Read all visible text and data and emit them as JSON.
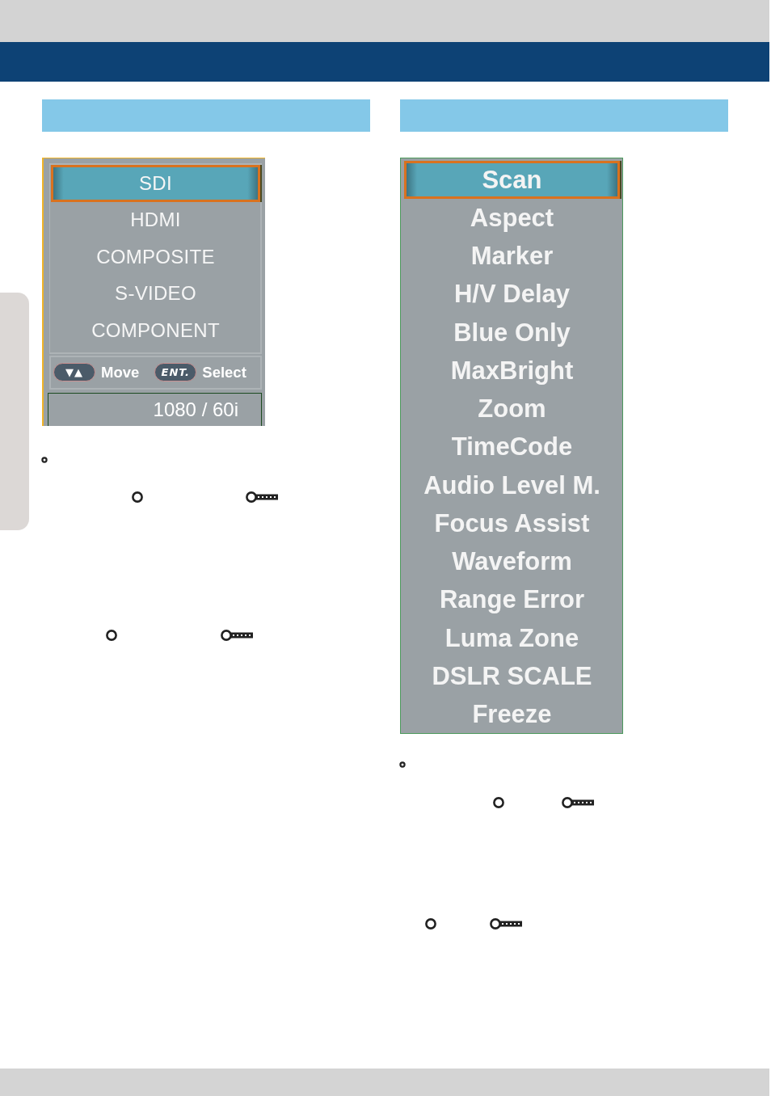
{
  "input_menu": {
    "items": [
      {
        "label": "SDI",
        "selected": true
      },
      {
        "label": "HDMI",
        "selected": false
      },
      {
        "label": "COMPOSITE",
        "selected": false
      },
      {
        "label": "S-VIDEO",
        "selected": false
      },
      {
        "label": "COMPONENT",
        "selected": false
      }
    ],
    "hints": [
      {
        "key": "▼▲",
        "label": "Move"
      },
      {
        "key": "ENT.",
        "label": "Select"
      }
    ],
    "status": "1080 / 60i"
  },
  "function_menu": {
    "items": [
      {
        "label": "Scan",
        "selected": true
      },
      {
        "label": "Aspect",
        "selected": false
      },
      {
        "label": "Marker",
        "selected": false
      },
      {
        "label": "H/V Delay",
        "selected": false
      },
      {
        "label": "Blue Only",
        "selected": false
      },
      {
        "label": "MaxBright",
        "selected": false
      },
      {
        "label": "Zoom",
        "selected": false
      },
      {
        "label": "TimeCode",
        "selected": false
      },
      {
        "label": "Audio Level M.",
        "selected": false
      },
      {
        "label": "Focus Assist",
        "selected": false
      },
      {
        "label": "Waveform",
        "selected": false
      },
      {
        "label": "Range Error",
        "selected": false
      },
      {
        "label": "Luma Zone",
        "selected": false
      },
      {
        "label": "DSLR SCALE",
        "selected": false
      },
      {
        "label": "Freeze",
        "selected": false
      }
    ]
  }
}
